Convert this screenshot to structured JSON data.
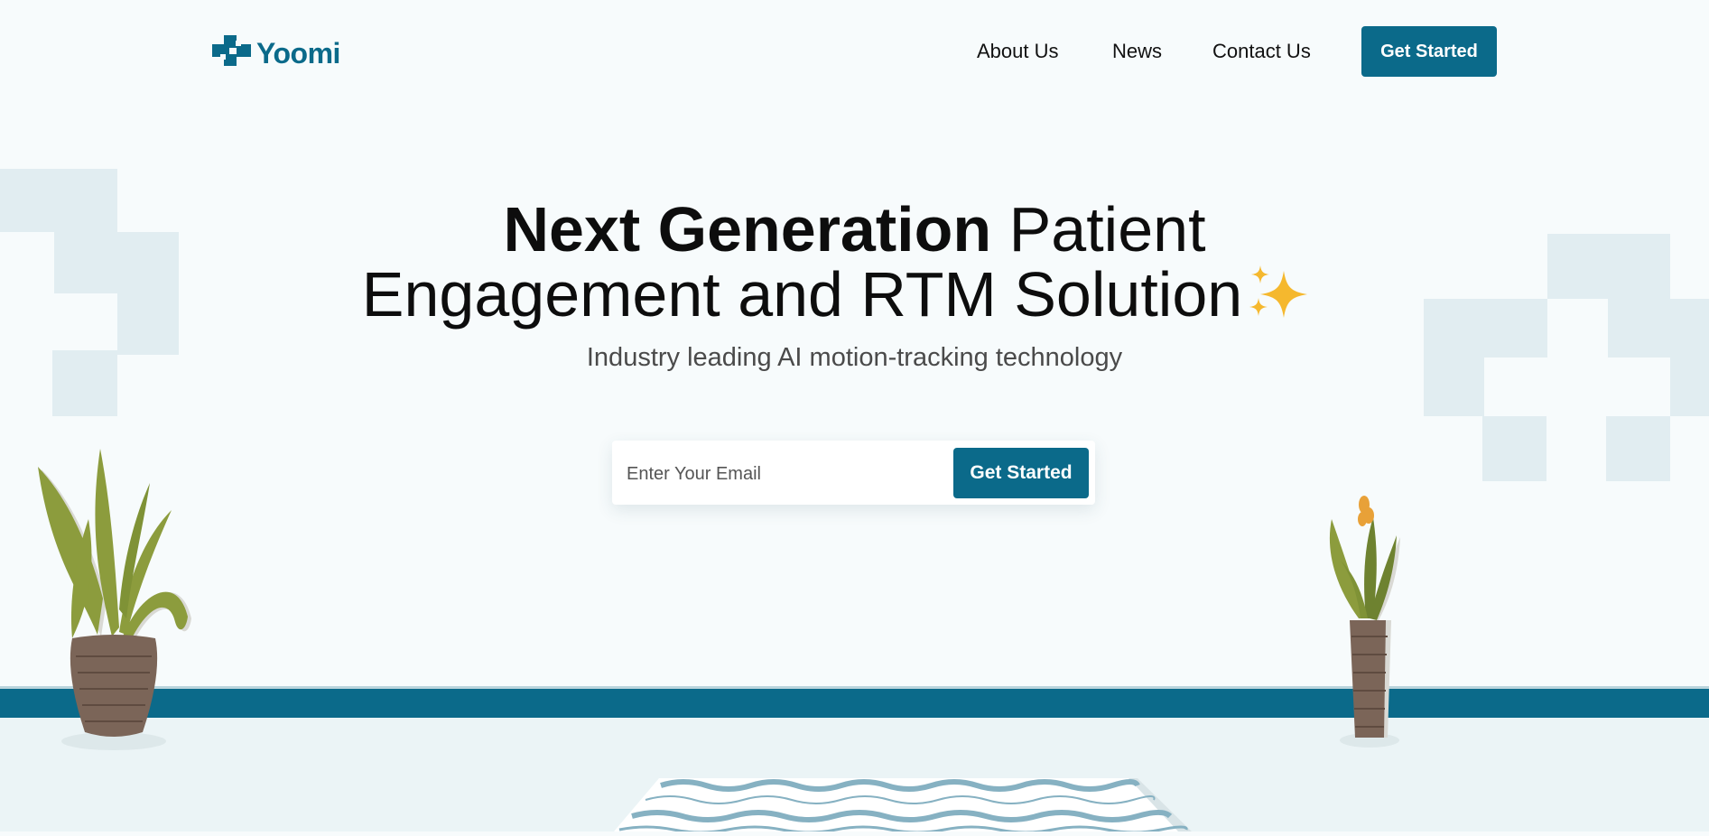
{
  "header": {
    "logo_text": "Yoomi",
    "nav": {
      "about": "About Us",
      "news": "News",
      "contact": "Contact Us"
    },
    "cta_label": "Get Started"
  },
  "hero": {
    "title_bold": "Next Generation",
    "title_rest_line1": " Patient",
    "title_line2": "Engagement and RTM Solution",
    "subtitle": "Industry leading AI motion-tracking technology",
    "email_placeholder": "Enter Your Email",
    "email_value": "",
    "submit_label": "Get Started"
  },
  "icons": {
    "logo": "medical-cross-icon",
    "sparkle": "sparkles-icon",
    "left_plant": "potted-plant-icon",
    "right_plant": "potted-plant-icon",
    "rug": "wavy-rug-icon"
  },
  "colors": {
    "brand": "#0b6a8a",
    "background": "#f7fbfc",
    "block": "#e1edf1",
    "sparkle": "#f5b82e"
  }
}
